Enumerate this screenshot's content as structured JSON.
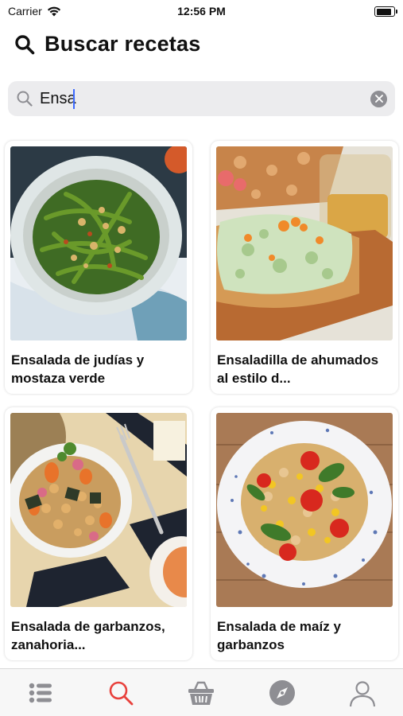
{
  "status_bar": {
    "carrier": "Carrier",
    "time": "12:56 PM",
    "battery_level": 0.85
  },
  "header": {
    "title": "Buscar recetas",
    "icon": "search-icon"
  },
  "search": {
    "value": "Ensa",
    "placeholder": ""
  },
  "recipes": [
    {
      "title": "Ensalada de judías y mostaza verde"
    },
    {
      "title": "Ensaladilla de ahumados al estilo d..."
    },
    {
      "title": "Ensalada de garbanzos, zanahoria..."
    },
    {
      "title": "Ensalada de maíz y garbanzos"
    }
  ],
  "tab_bar": {
    "active": "search",
    "tabs": [
      {
        "id": "list",
        "icon": "list-icon"
      },
      {
        "id": "search",
        "icon": "search-icon"
      },
      {
        "id": "basket",
        "icon": "basket-icon"
      },
      {
        "id": "explore",
        "icon": "compass-icon"
      },
      {
        "id": "profile",
        "icon": "user-icon"
      }
    ]
  },
  "colors": {
    "accent": "#e8413c",
    "tab_inactive": "#8e8e93",
    "search_bg": "#ececee",
    "caret": "#3d6bff"
  }
}
